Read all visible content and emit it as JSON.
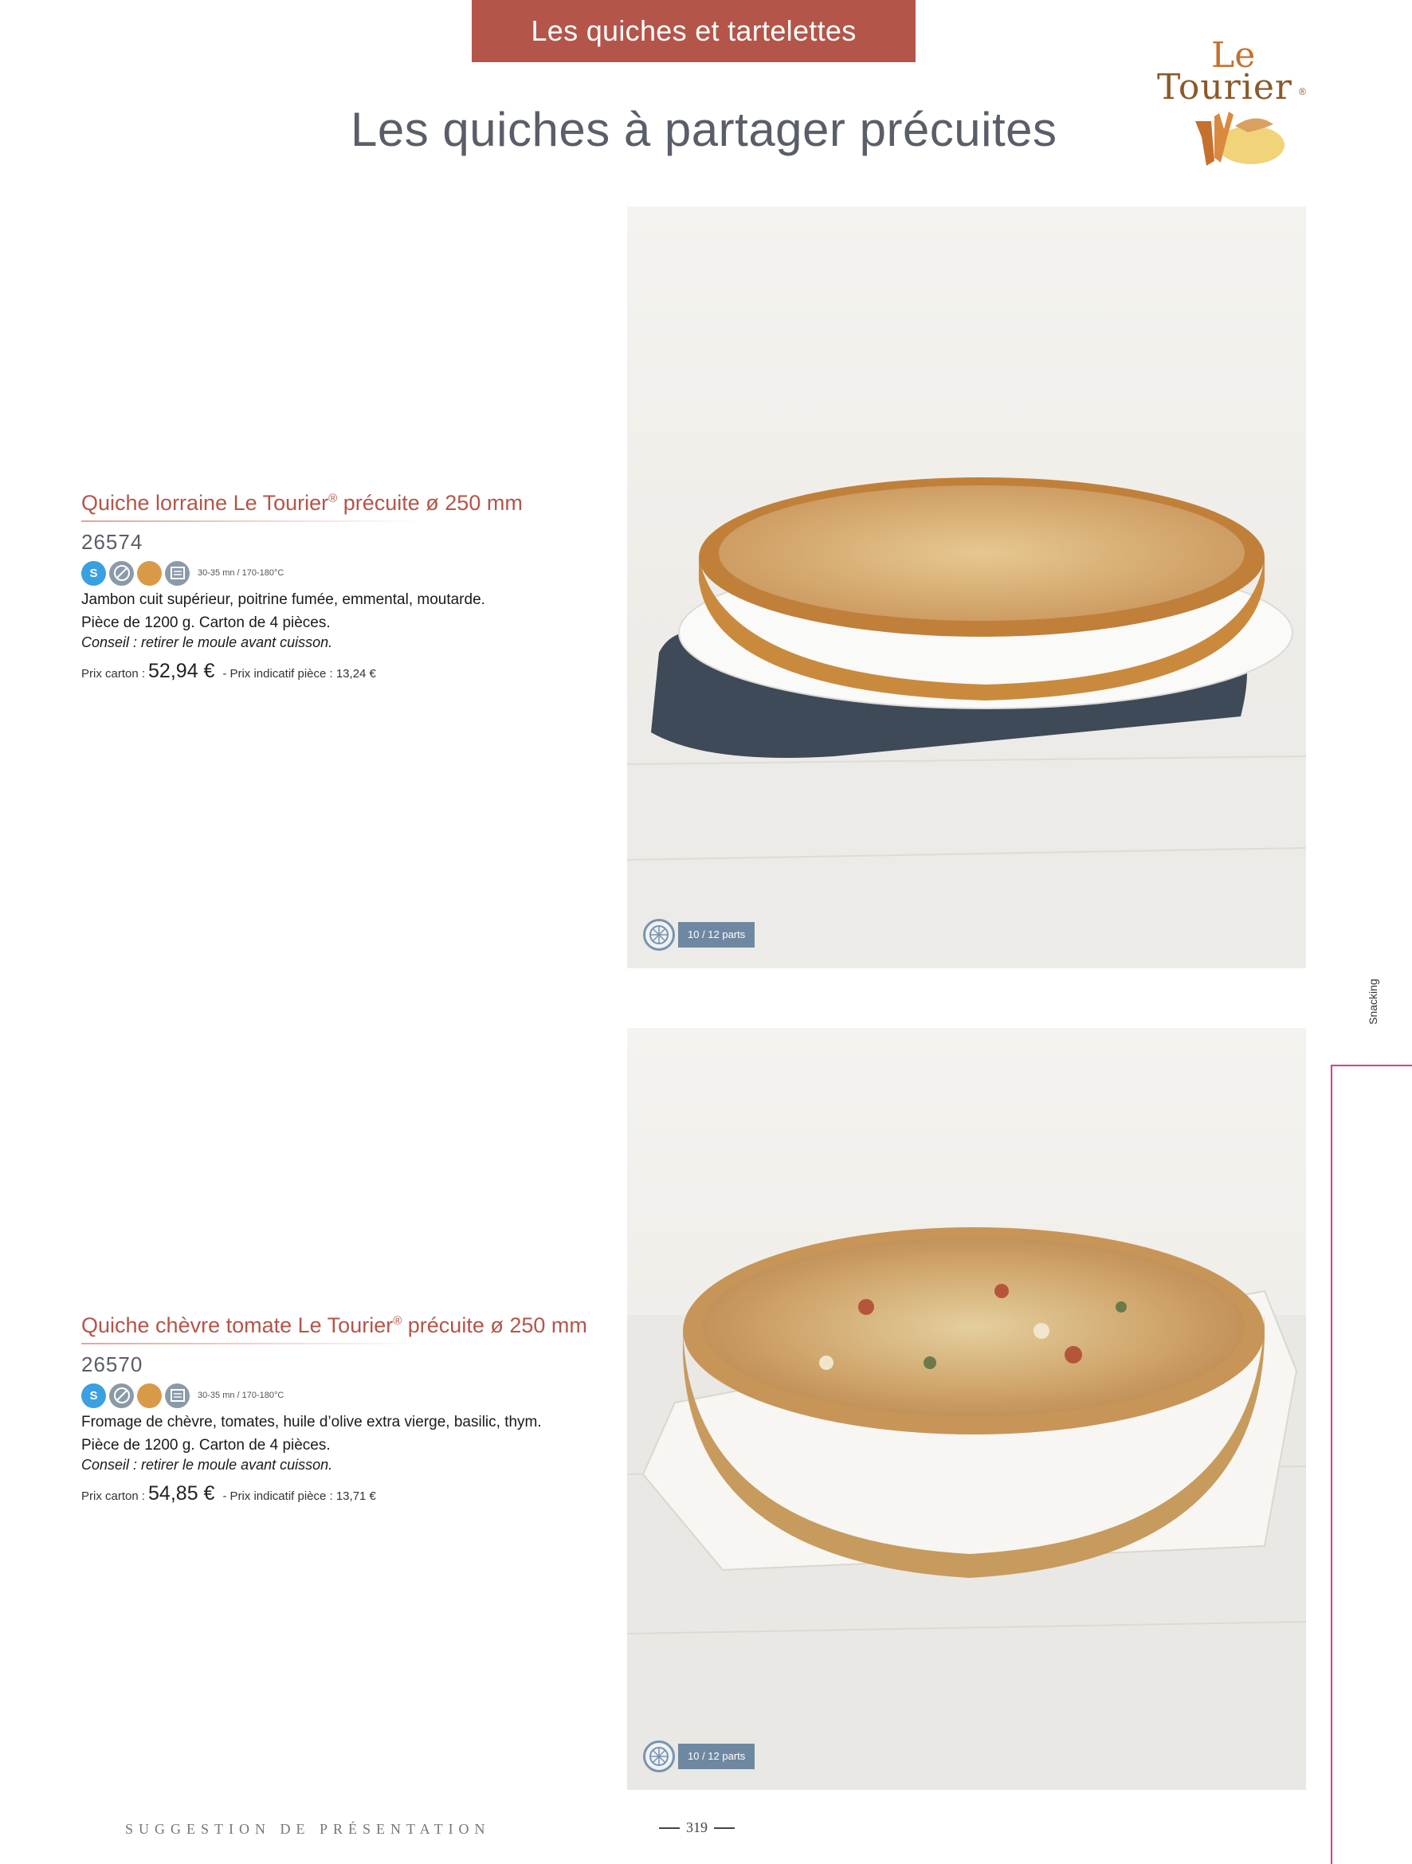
{
  "header": {
    "banner": "Les quiches et tartelettes",
    "title": "Les quiches à partager précuites"
  },
  "logo": {
    "le": "Le",
    "tourier": "Tourier",
    "reg": "®"
  },
  "products": [
    {
      "title_a": "Quiche lorraine Le Tourier",
      "reg": "®",
      "title_b": " précuite ø 250 mm",
      "code": "26574",
      "icons": [
        "s-icon",
        "no-fork-icon",
        "orange-circle-icon",
        "oven-icon"
      ],
      "s_label": "S",
      "cooking": "30-35 mn / 170-180°C",
      "description": "Jambon cuit supérieur, poitrine fumée, emmental, moutarde.",
      "piece": "Pièce de 1200 g. Carton de 4 pièces.",
      "tip": "Conseil : retirer le moule avant cuisson.",
      "price_label": "Prix carton :",
      "price": "52,94 €",
      "unit_price_text": "Prix indicatif pièce : 13,24 €",
      "parts": "10 / 12 parts"
    },
    {
      "title_a": "Quiche chèvre tomate Le Tourier",
      "reg": "®",
      "title_b": " précuite ø 250 mm",
      "code": "26570",
      "icons": [
        "s-icon",
        "no-fork-icon",
        "orange-circle-icon",
        "oven-icon"
      ],
      "s_label": "S",
      "cooking": "30-35 mn / 170-180°C",
      "description": "Fromage de chèvre, tomates, huile d’olive extra vierge, basilic, thym.",
      "piece": "Pièce de 1200 g. Carton de 4 pièces.",
      "tip": "Conseil : retirer le moule avant cuisson.",
      "price_label": "Prix carton :",
      "price": "54,85 €",
      "unit_price_text": "Prix indicatif pièce : 13,71 €",
      "parts": "10 / 12 parts"
    }
  ],
  "side_tab": "Snacking",
  "footer": {
    "suggestion": "SUGGESTION DE PRÉSENTATION",
    "page": "319"
  }
}
